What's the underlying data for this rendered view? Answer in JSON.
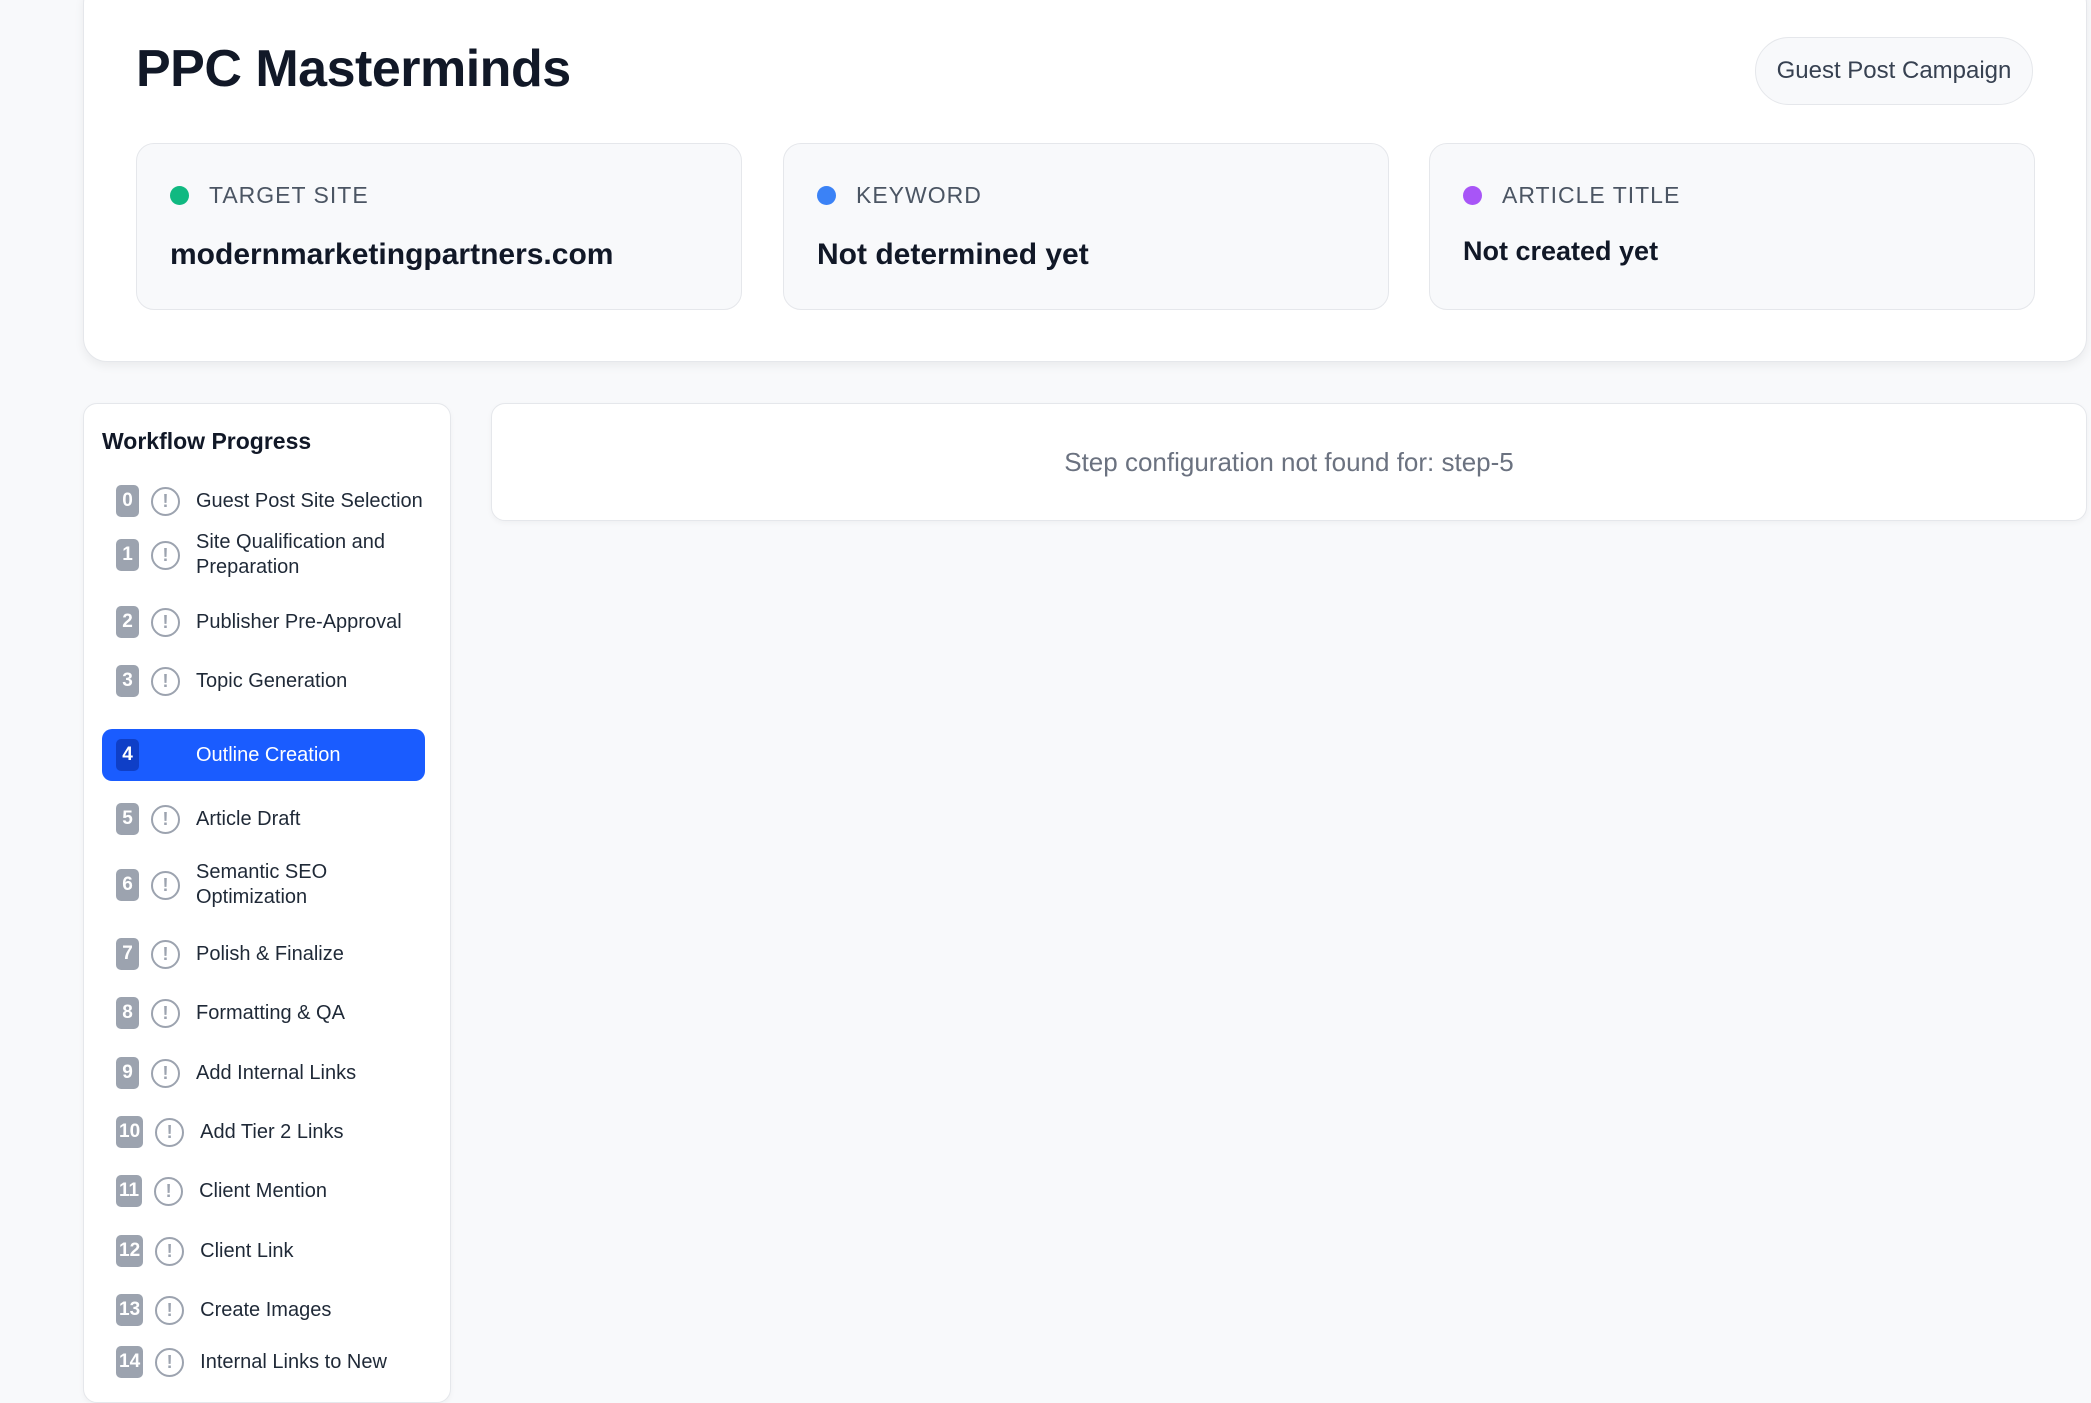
{
  "header": {
    "title": "PPC Masterminds",
    "campaign_label": "Guest Post Campaign"
  },
  "info_cards": [
    {
      "label": "TARGET SITE",
      "value": "modernmarketingpartners.com",
      "dot_color": "#10b981"
    },
    {
      "label": "KEYWORD",
      "value": "Not determined yet",
      "dot_color": "#3b82f6"
    },
    {
      "label": "ARTICLE TITLE",
      "value": "Not created yet",
      "dot_color": "#a855f7"
    }
  ],
  "sidebar": {
    "title": "Workflow Progress",
    "steps": [
      {
        "num": "0",
        "label": "Guest Post Site Selection",
        "icon": "alert-circle-icon"
      },
      {
        "num": "1",
        "label": "Site Qualification and Preparation",
        "icon": "alert-circle-icon"
      },
      {
        "num": "2",
        "label": "Publisher Pre-Approval",
        "icon": "alert-circle-icon"
      },
      {
        "num": "3",
        "label": "Topic Generation",
        "icon": "alert-circle-icon"
      },
      {
        "num": "4",
        "label": "Outline Creation",
        "icon": "alert-circle-icon",
        "active": true
      },
      {
        "num": "5",
        "label": "Article Draft",
        "icon": "alert-circle-icon"
      },
      {
        "num": "6",
        "label": "Semantic SEO Optimization",
        "icon": "alert-circle-icon"
      },
      {
        "num": "7",
        "label": "Polish & Finalize",
        "icon": "alert-circle-icon"
      },
      {
        "num": "8",
        "label": "Formatting & QA",
        "icon": "alert-circle-icon"
      },
      {
        "num": "9",
        "label": "Add Internal Links",
        "icon": "alert-circle-icon"
      },
      {
        "num": "10",
        "label": "Add Tier 2 Links",
        "icon": "alert-circle-icon"
      },
      {
        "num": "11",
        "label": "Client Mention",
        "icon": "alert-circle-icon"
      },
      {
        "num": "12",
        "label": "Client Link",
        "icon": "alert-circle-icon"
      },
      {
        "num": "13",
        "label": "Create Images",
        "icon": "alert-circle-icon"
      },
      {
        "num": "14",
        "label": "Internal Links to New",
        "icon": "alert-circle-icon"
      }
    ]
  },
  "content": {
    "message": "Step configuration not found for: step-5"
  },
  "colors": {
    "accent": "#1a5cff",
    "badge_gray": "#9ca3af"
  }
}
